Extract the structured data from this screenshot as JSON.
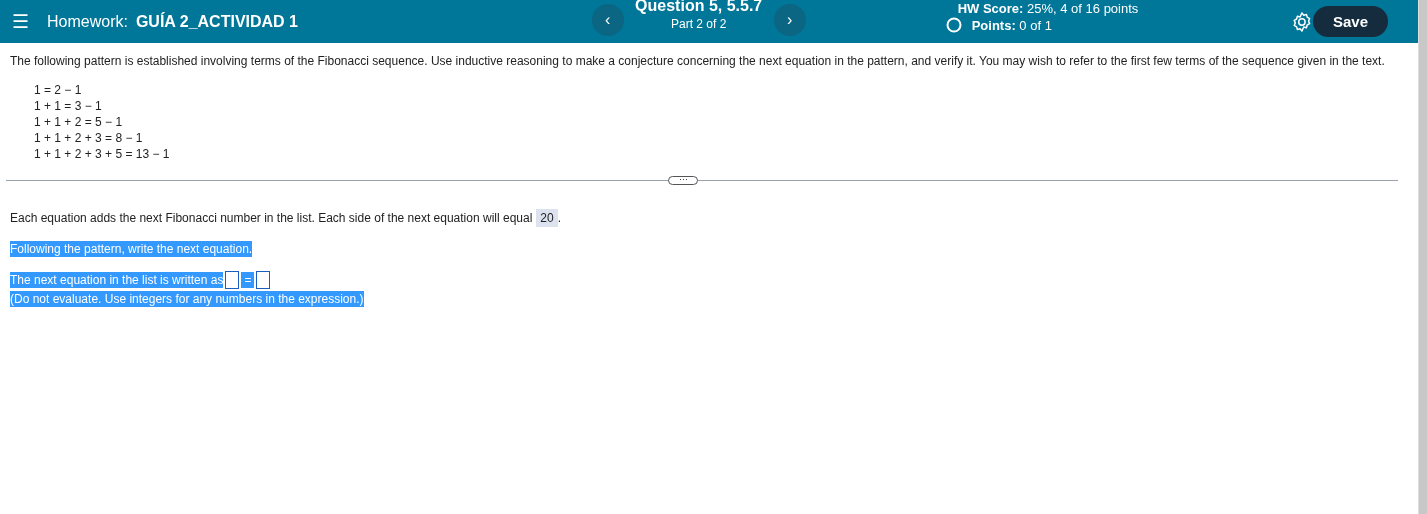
{
  "header": {
    "menu_icon": "☰",
    "homework_label": "Homework:",
    "homework_title": "GUÍA 2_ACTIVIDAD 1",
    "question": "Question 5, 5.5.7",
    "part": "Part 2 of 2",
    "prev": "‹",
    "next": "›",
    "score_label": "HW Score:",
    "score_value": "25%, 4 of 16 points",
    "points_label": "Points:",
    "points_value": "0 of 1",
    "save": "Save"
  },
  "question": {
    "intro": "The following pattern is established involving terms of the Fibonacci sequence. Use inductive reasoning to make a conjecture concerning the next equation in the pattern, and verify it. You may wish to refer to the first few terms of the sequence given in the text.",
    "equations": [
      "1 = 2 − 1",
      "1 + 1 = 3 − 1",
      "1 + 1 + 2 = 5 − 1",
      "1 + 1 + 2 + 3 = 8 − 1",
      "1 + 1 + 2 + 3 + 5 = 13 − 1"
    ],
    "divider_handle": "⋯"
  },
  "answer": {
    "text": "Each equation adds the next Fibonacci number in the list. Each side of the next equation will equal",
    "value": "20",
    "suffix": ".",
    "lines": [
      {
        "text": "Following the pattern, write the next equation.",
        "highlighted": true,
        "kind": "plain"
      },
      {
        "text": "The next equation in the list is written as",
        "highlighted": true,
        "kind": "equation",
        "equals": "="
      },
      {
        "text": "(Do not evaluate. Use integers for any numbers in the expression.)",
        "highlighted": true,
        "kind": "note"
      }
    ]
  }
}
